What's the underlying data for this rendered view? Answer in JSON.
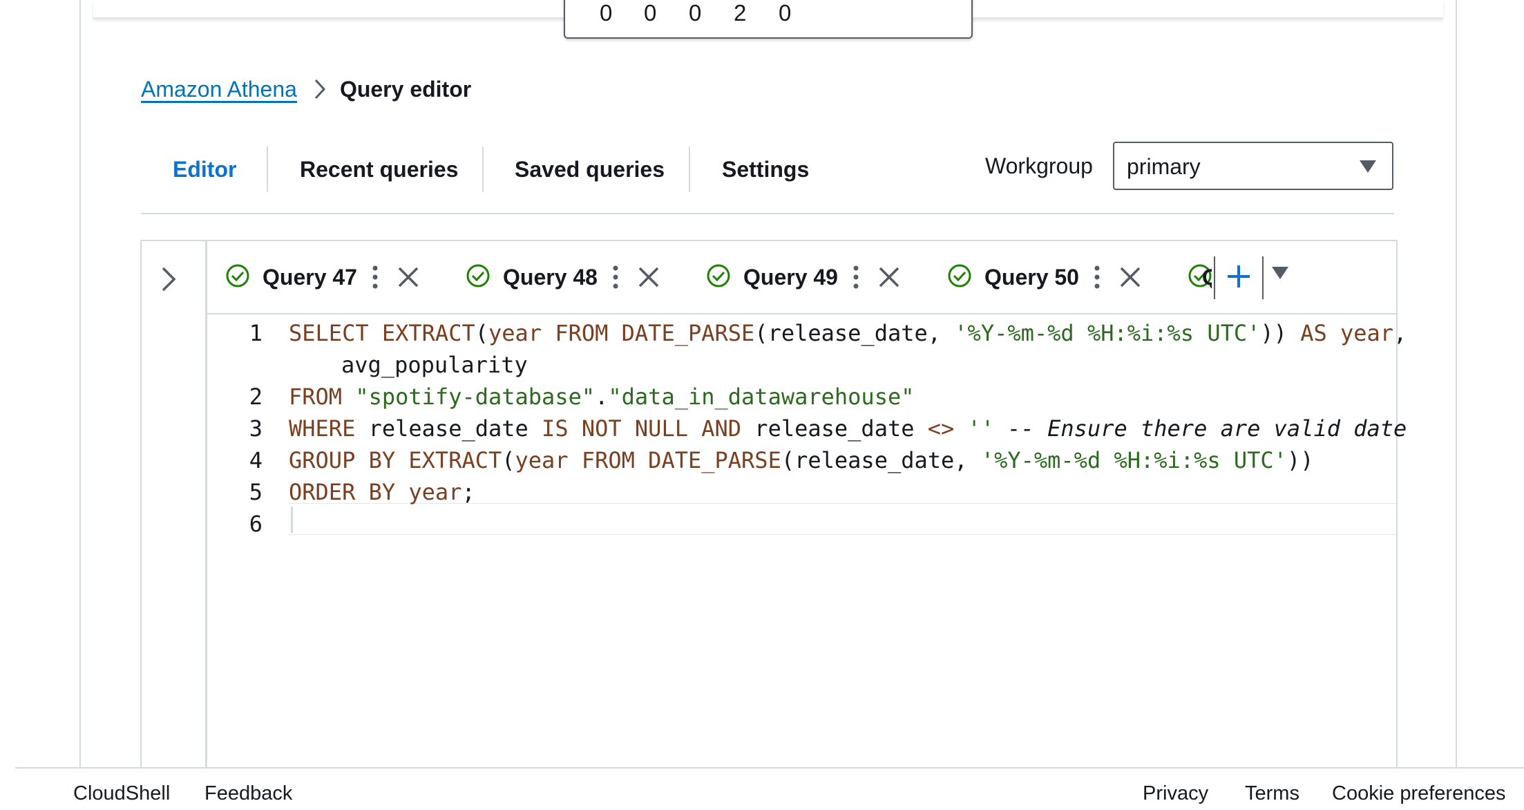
{
  "counter": {
    "digits": [
      "0",
      "0",
      "0",
      "2",
      "0"
    ]
  },
  "breadcrumb": {
    "root": "Amazon Athena",
    "current": "Query editor"
  },
  "nav_tabs": {
    "editor": "Editor",
    "recent": "Recent queries",
    "saved": "Saved queries",
    "settings": "Settings"
  },
  "workgroup": {
    "label": "Workgroup",
    "value": "primary"
  },
  "query_tabs": [
    {
      "label": "Query 47",
      "status": "success"
    },
    {
      "label": "Query 48",
      "status": "success"
    },
    {
      "label": "Query 49",
      "status": "success"
    },
    {
      "label": "Query 50",
      "status": "success"
    }
  ],
  "truncated_tab_label": "Q",
  "code": {
    "line_numbers": [
      "1",
      "2",
      "3",
      "4",
      "5",
      "6"
    ],
    "l1": {
      "kw1": "SELECT EXTRACT",
      "p1": "(",
      "kw2": "year FROM DATE_PARSE",
      "p2": "(release_date, ",
      "str": "'%Y-%m-%d %H:%i:%s UTC'",
      "p3": ")) ",
      "kw3": "AS year",
      "p4": ","
    },
    "l1b": "avg_popularity",
    "l2": {
      "kw": "FROM ",
      "str1": "\"spotify-database\"",
      "dot": ".",
      "str2": "\"data_in_datawarehouse\""
    },
    "l3": {
      "kw1": "WHERE ",
      "t1": "release_date ",
      "kw2": "IS NOT NULL AND ",
      "t2": "release_date ",
      "op": "<> ",
      "str": "''",
      "cm": " -- Ensure there are valid date"
    },
    "l4": {
      "kw1": "GROUP BY EXTRACT",
      "p1": "(",
      "kw2": "year FROM DATE_PARSE",
      "p2": "(release_date, ",
      "str": "'%Y-%m-%d %H:%i:%s UTC'",
      "p3": "))"
    },
    "l5": {
      "kw1": "ORDER BY ",
      "kw2": "year",
      "p1": ";"
    }
  },
  "footer": {
    "cloudshell": "CloudShell",
    "feedback": "Feedback",
    "privacy": "Privacy",
    "terms": "Terms",
    "cookies": "Cookie preferences"
  },
  "colors": {
    "link": "#0073bb",
    "active_tab": "#0972d3",
    "success": "#1d8102",
    "keyword": "#7a3e20",
    "string": "#2b6a1f"
  }
}
